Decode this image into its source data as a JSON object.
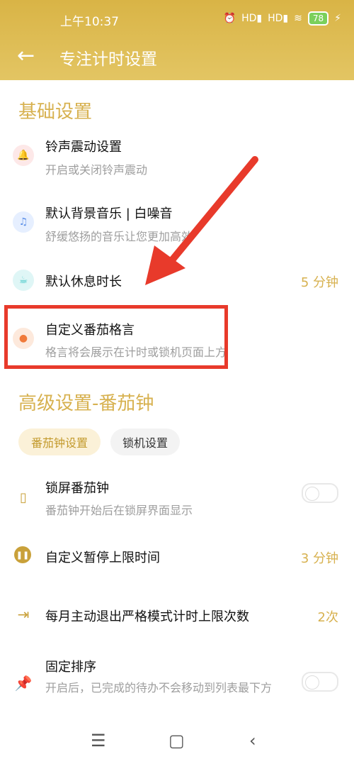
{
  "status_bar": {
    "time": "上午10:37",
    "icons": [
      "alarm-icon",
      "hd-signal-icon",
      "hd-signal-icon",
      "wifi-icon"
    ],
    "battery": "78"
  },
  "header": {
    "title": "专注计时设置"
  },
  "basic": {
    "title": "基础设置",
    "items": [
      {
        "title": "铃声震动设置",
        "subtitle": "开启或关闭铃声震动",
        "icon": "bell-icon"
      },
      {
        "title": "默认背景音乐 | 白噪音",
        "subtitle": "舒缓悠扬的音乐让您更加高效",
        "icon": "music-note-icon"
      },
      {
        "title": "默认休息时长",
        "value": "5 分钟",
        "icon": "cup-icon"
      },
      {
        "title": "自定义番茄格言",
        "subtitle": "格言将会展示在计时或锁机页面上方",
        "icon": "chat-bubble-icon"
      }
    ]
  },
  "advanced": {
    "title": "高级设置-番茄钟",
    "tabs": [
      "番茄钟设置",
      "锁机设置"
    ],
    "items": [
      {
        "title": "锁屏番茄钟",
        "subtitle": "番茄钟开始后在锁屏界面显示",
        "icon": "phone-lock-icon"
      },
      {
        "title": "自定义暂停上限时间",
        "value": "3 分钟",
        "icon": "pause-icon"
      },
      {
        "title": "每月主动退出严格模式计时上限次数",
        "value": "2次",
        "icon": "exit-icon"
      },
      {
        "title": "固定排序",
        "subtitle": "开启后，已完成的待办不会移动到列表最下方",
        "icon": "pin-icon"
      }
    ]
  },
  "colors": {
    "accent": "#d7b14f",
    "header": "#dcb94c",
    "annotation": "#e83a2b"
  }
}
